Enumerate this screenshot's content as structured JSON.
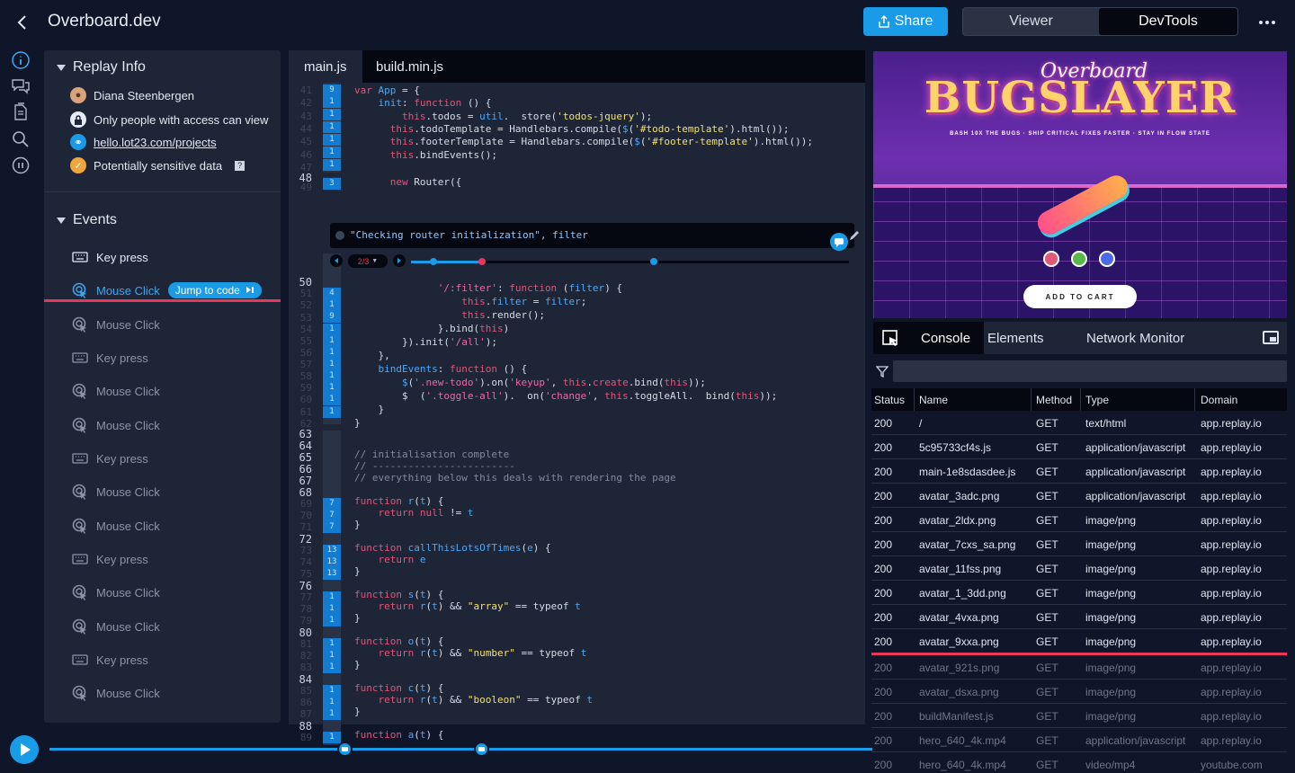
{
  "app": {
    "title": "Overboard.dev"
  },
  "header": {
    "share_label": "Share",
    "view_viewer": "Viewer",
    "view_devtools": "DevTools"
  },
  "replay_info": {
    "title": "Replay Info",
    "user": "Diana Steenbergen",
    "privacy": "Only people with access can view",
    "url": "hello.lot23.com/projects",
    "sensitive": "Potentially sensitive data",
    "help": "?"
  },
  "events": {
    "title": "Events",
    "jump_label": "Jump to code",
    "items": [
      {
        "label": "Key press",
        "type": "key"
      },
      {
        "label": "Mouse Click",
        "type": "mouse"
      },
      {
        "label": "Mouse Click",
        "type": "mouse"
      },
      {
        "label": "Key press",
        "type": "key"
      },
      {
        "label": "Mouse Click",
        "type": "mouse"
      },
      {
        "label": "Mouse Click",
        "type": "mouse"
      },
      {
        "label": "Key press",
        "type": "key"
      },
      {
        "label": "Mouse Click",
        "type": "mouse"
      },
      {
        "label": "Mouse Click",
        "type": "mouse"
      },
      {
        "label": "Key press",
        "type": "key"
      },
      {
        "label": "Mouse Click",
        "type": "mouse"
      },
      {
        "label": "Mouse Click",
        "type": "mouse"
      },
      {
        "label": "Key press",
        "type": "key"
      },
      {
        "label": "Mouse Click",
        "type": "mouse"
      }
    ]
  },
  "editor": {
    "tabs": [
      "main.js",
      "build.min.js"
    ],
    "logpoint": "\"Checking router initialization\", filter",
    "logpoint_counter": "2/3",
    "line_numbers": [
      "41",
      "42",
      "43",
      "44",
      "45",
      "46",
      "47",
      "48",
      "49",
      "50",
      "51",
      "52",
      "53",
      "54",
      "55",
      "56",
      "57",
      "58",
      "59",
      "60",
      "61",
      "62",
      "63",
      "64",
      "65",
      "66",
      "67",
      "68",
      "69",
      "70",
      "71",
      "72",
      "73",
      "74",
      "75",
      "76",
      "77",
      "78",
      "79",
      "80",
      "81",
      "82",
      "83",
      "84",
      "85",
      "86",
      "87",
      "88",
      "89"
    ],
    "hit_counts_top": [
      "9",
      "1",
      "1",
      "1",
      "1",
      "1",
      "1",
      "3"
    ],
    "hit_counts_mid": [
      "4",
      "1",
      "9",
      "1",
      "1",
      "1",
      "1",
      "1",
      "1",
      "1",
      "1"
    ],
    "hit_counts_fns": [
      "7",
      "7",
      "7",
      "13",
      "13",
      "13",
      "1",
      "1",
      "1",
      "1",
      "1",
      "1",
      "1",
      "1",
      "1",
      "1"
    ]
  },
  "preview": {
    "brand_script": "Overboard",
    "brand": "BUGSLAYER",
    "tagline": "BASH 10X THE BUGS · SHIP CRITICAL FIXES FASTER · STAY IN FLOW STATE",
    "cart_label": "ADD TO CART",
    "swatches": [
      "#e05a7a",
      "#5ab84a",
      "#4a6ae8"
    ]
  },
  "devtools": {
    "tabs": [
      "Console",
      "Elements",
      "Network Monitor"
    ],
    "columns": [
      "Status",
      "Name",
      "Method",
      "Type",
      "Domain"
    ],
    "rows": [
      [
        "200",
        "/",
        "GET",
        "text/html",
        "app.replay.io"
      ],
      [
        "200",
        "5c95733cf4s.js",
        "GET",
        "application/javascript",
        "app.replay.io"
      ],
      [
        "200",
        "main-1e8sdasdee.js",
        "GET",
        "application/javascript",
        "app.replay.io"
      ],
      [
        "200",
        "avatar_3adc.png",
        "GET",
        "application/javascript",
        "app.replay.io"
      ],
      [
        "200",
        "avatar_2ldx.png",
        "GET",
        "image/png",
        "app.replay.io"
      ],
      [
        "200",
        "avatar_7cxs_sa.png",
        "GET",
        "image/png",
        "app.replay.io"
      ],
      [
        "200",
        "avatar_11fss.png",
        "GET",
        "image/png",
        "app.replay.io"
      ],
      [
        "200",
        "avatar_1_3dd.png",
        "GET",
        "image/png",
        "app.replay.io"
      ],
      [
        "200",
        "avatar_4vxa.png",
        "GET",
        "image/png",
        "app.replay.io"
      ],
      [
        "200",
        "avatar_9xxa.png",
        "GET",
        "image/png",
        "app.replay.io"
      ]
    ],
    "future_rows": [
      [
        "200",
        "avatar_921s.png",
        "GET",
        "image/png",
        "app.replay.io"
      ],
      [
        "200",
        "avatar_dsxa.png",
        "GET",
        "image/png",
        "app.replay.io"
      ],
      [
        "200",
        "buildManifest.js",
        "GET",
        "image/png",
        "app.replay.io"
      ],
      [
        "200",
        "hero_640_4k.mp4",
        "GET",
        "application/javascript",
        "app.replay.io"
      ],
      [
        "200",
        "hero_640_4k.mp4",
        "GET",
        "video/mp4",
        "youtube.com"
      ]
    ]
  },
  "colors": {
    "accent": "#1a9be8",
    "now_marker": "#e8375b",
    "panel": "#1e2536",
    "background": "#0f1629"
  }
}
